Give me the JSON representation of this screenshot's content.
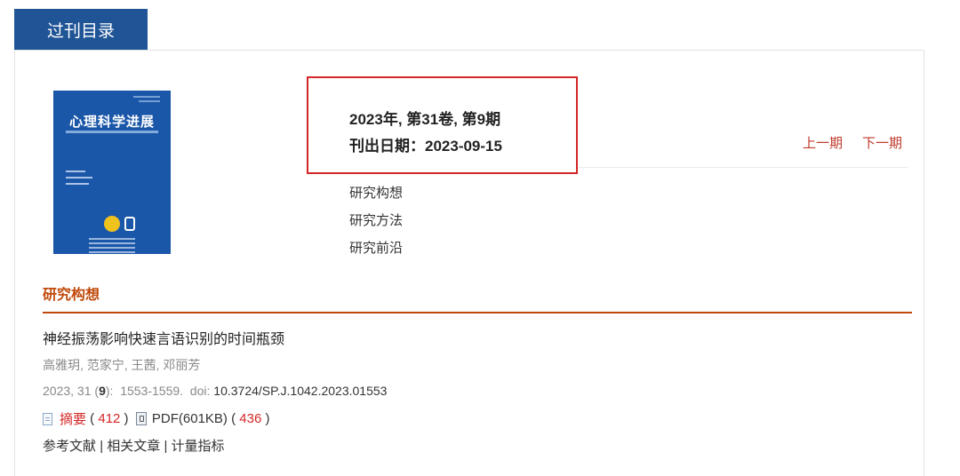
{
  "tab": {
    "label": "过刊目录"
  },
  "cover": {
    "title": "心理科学进展"
  },
  "issue": {
    "volume_line": "2023年, 第31卷, 第9期",
    "date_line": "刊出日期：2023-09-15"
  },
  "nav": {
    "prev": "上一期",
    "next": "下一期"
  },
  "categories": [
    "研究构想",
    "研究方法",
    "研究前沿"
  ],
  "section": {
    "title": "研究构想"
  },
  "article": {
    "title": "神经振荡影响快速言语识别的时间瓶颈",
    "authors": "高雅玥, 范家宁, 王茜, 邓丽芳",
    "citation_prefix": "2023, 31 (",
    "citation_issue": "9",
    "citation_suffix": "):  1553-1559.  doi: ",
    "doi": "10.3724/SP.J.1042.2023.01553",
    "abstract_label": "摘要",
    "abstract_count": "412",
    "pdf_label": "PDF(601KB)",
    "pdf_count": "436",
    "bottom_links": [
      "参考文献",
      "相关文章",
      "计量指标"
    ]
  },
  "colors": {
    "tab_bg": "#1f5496",
    "accent": "#c0480a",
    "highlight_box": "#d42626"
  }
}
